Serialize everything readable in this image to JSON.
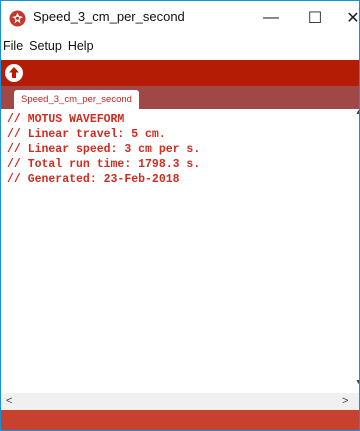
{
  "window": {
    "title": "Speed_3_cm_per_second",
    "minimize_glyph": "—",
    "maximize_glyph": "☐",
    "close_glyph": "✕"
  },
  "menu": {
    "file": "File",
    "setup": "Setup",
    "help": "Help"
  },
  "toolbar": {
    "upload_icon": "upload-arrow-icon"
  },
  "tabs": [
    {
      "label": "Speed_3_cm_per_second"
    }
  ],
  "editor": {
    "lines": [
      "// MOTUS WAVEFORM",
      "// Linear travel: 5 cm.",
      "// Linear speed: 3 cm per s.",
      "// Total run time: 1798.3 s.",
      "// Generated: 23-Feb-2018"
    ]
  },
  "scrollbar": {
    "left_glyph": "<",
    "right_glyph": ">",
    "up_glyph": "▲",
    "down_glyph": "▼"
  },
  "colors": {
    "toolbar": "#b51c06",
    "tabstrip": "#a14846",
    "code_text": "#d22b1f",
    "statusbar": "#c7412f"
  }
}
